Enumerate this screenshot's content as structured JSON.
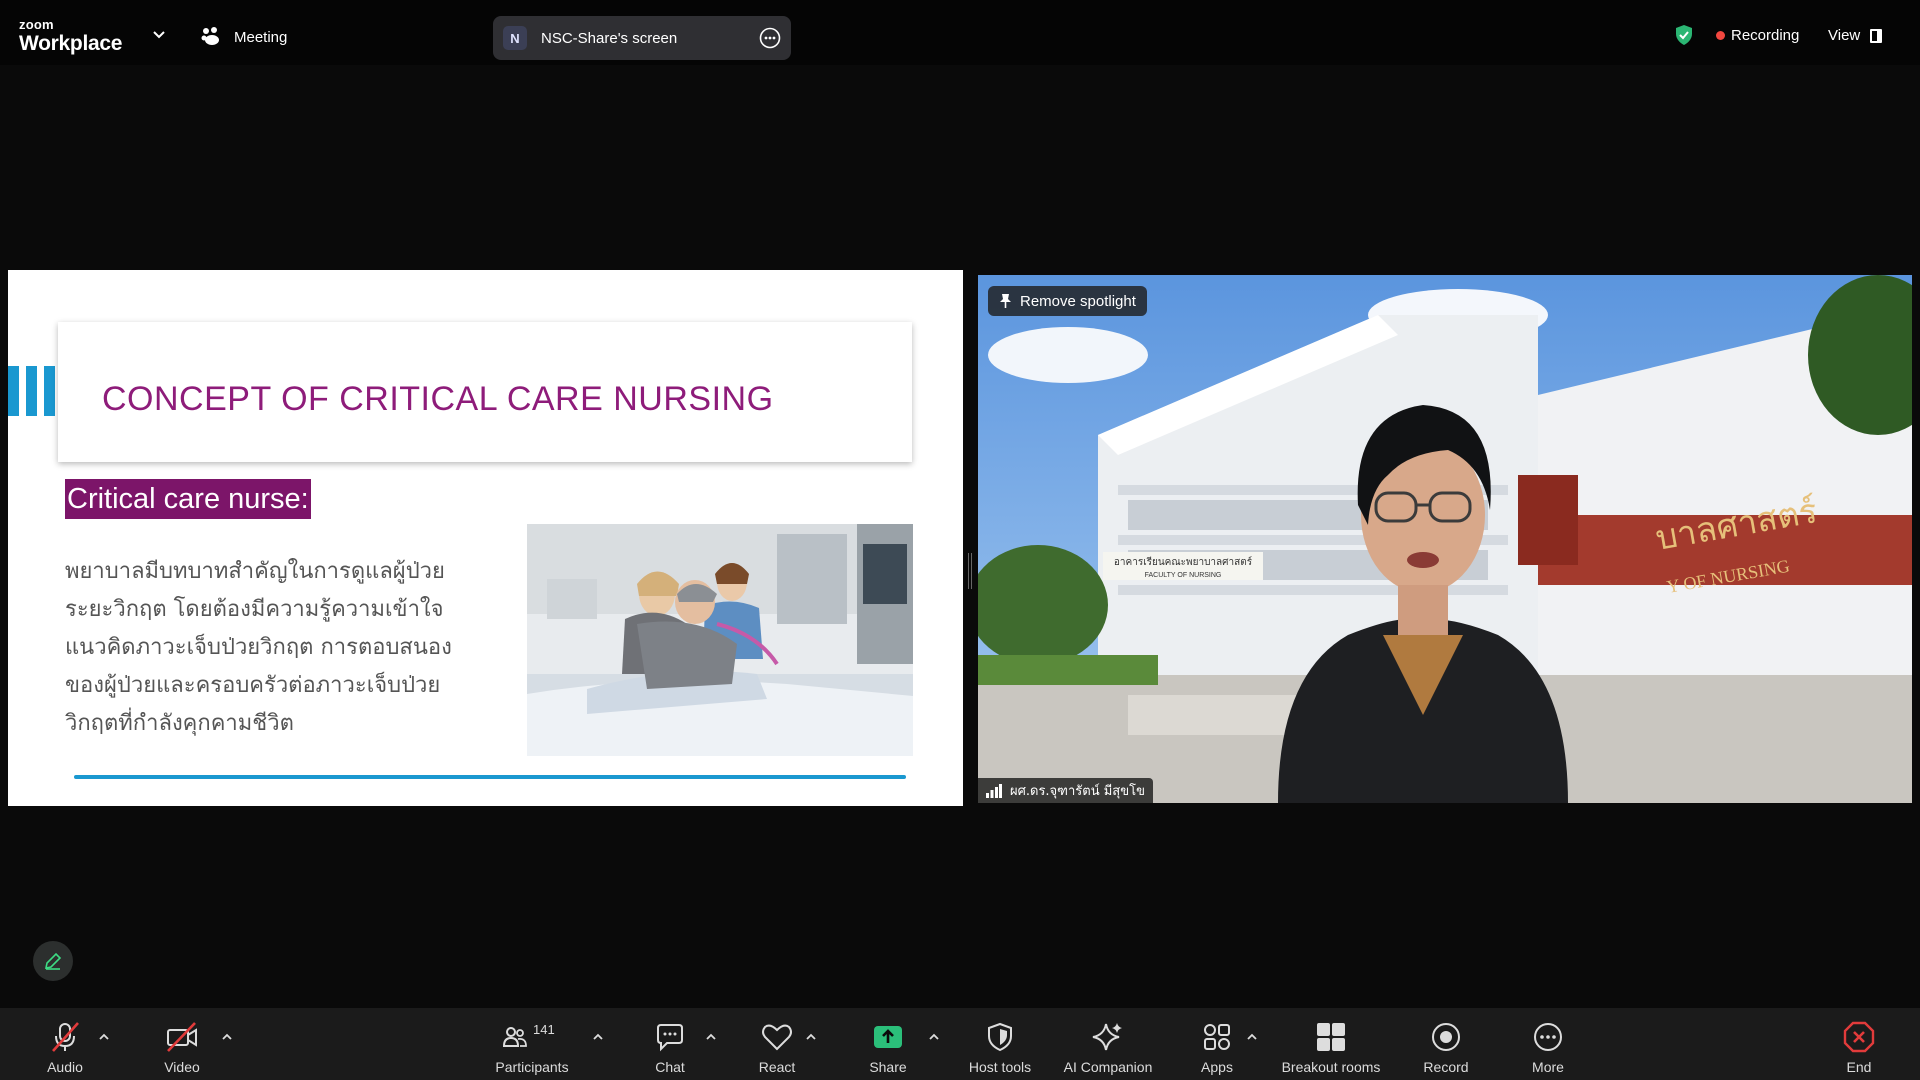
{
  "app": {
    "brand_top": "zoom",
    "brand_bottom": "Workplace",
    "meeting_label": "Meeting",
    "share_initial": "N",
    "share_label": "NSC-Share's screen",
    "recording_label": "Recording",
    "view_label": "View",
    "colors": {
      "recording": "#f2473f",
      "shield": "#2bb673",
      "share_green": "#2bbf7a"
    }
  },
  "slide": {
    "title": "CONCEPT OF CRITICAL CARE NURSING",
    "subtitle": "Critical care nurse:",
    "body_lines": [
      "พยาบาลมีบทบาทสำคัญในการดูแลผู้ป่วย",
      "ระยะวิกฤต โดยต้องมีความรู้ความเข้าใจ",
      "แนวคิดภาวะเจ็บป่วยวิกฤต การตอบสนอง",
      "ของผู้ป่วยและครอบครัวต่อภาวะเจ็บป่วย",
      "วิกฤตที่กำลังคุกคามชีวิต"
    ],
    "colors": {
      "title": "#8e1c7a",
      "chip": "#7c1569",
      "accent": "#1a98d0"
    }
  },
  "video": {
    "spotlight_label": "Remove spotlight",
    "participant_name": "ผศ.ดร.จุฑารัตน์ มีสุขโข",
    "building_sign_th": "อาคารเรียนคณะพยาบาลศาสตร์",
    "building_sign_en": "FACULTY OF NURSING",
    "wall_sign_th": "บาลศาสตร์",
    "wall_sign_en": "Y OF NURSING"
  },
  "toolbar": {
    "audio": "Audio",
    "video": "Video",
    "participants": "Participants",
    "participants_count": "141",
    "chat": "Chat",
    "react": "React",
    "share": "Share",
    "host_tools": "Host tools",
    "ai_companion": "AI Companion",
    "apps": "Apps",
    "breakout_rooms": "Breakout rooms",
    "record": "Record",
    "more": "More",
    "end": "End"
  }
}
